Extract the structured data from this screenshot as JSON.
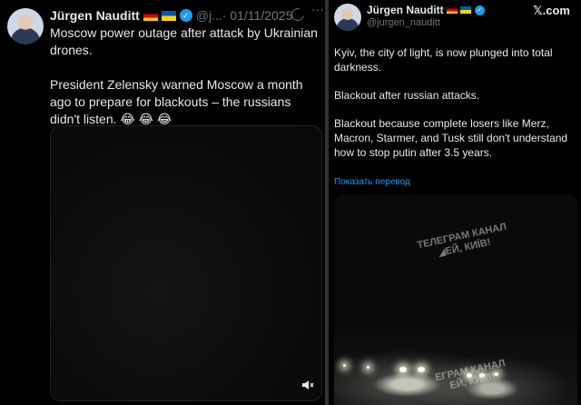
{
  "left_tweet": {
    "author_name": "Jürgen Nauditt",
    "handle": "@j...",
    "date": "· 01/11/2025",
    "more": "···",
    "paragraphs": [
      "Moscow power outage after attack by Ukrainian drones.",
      "President Zelensky warned Moscow a month ago to prepare for blackouts – the russians didn't listen. 😂 😂 😂"
    ],
    "icons": [
      "verified-icon",
      "grok-icon",
      "more-icon",
      "mute-icon"
    ]
  },
  "right_tweet": {
    "author_name": "Jürgen Nauditt",
    "handle": "@jurgen_nauditt",
    "brand": "𝕏.com",
    "paragraphs": [
      "Kyiv, the city of light, is now plunged into total darkness.",
      "Blackout after russian attacks.",
      "Blackout because complete losers like Merz, Macron, Starmer, and Tusk still don't understand how to stop putin after 3.5 years."
    ],
    "translate_link": "Показать перевод",
    "watermark_top_line1": "ТЕЛЕГРАМ КАНАЛ",
    "watermark_top_line2": "◢ЕЙ, КИЇВ!",
    "watermark_bottom_line1": "ЕГРАМ КАНАЛ",
    "watermark_bottom_line2": "ЕЙ, КИЇВ!"
  },
  "colors": {
    "background": "#000000",
    "text": "#e7e9ea",
    "muted": "#71767b",
    "accent": "#1d9bf0"
  }
}
